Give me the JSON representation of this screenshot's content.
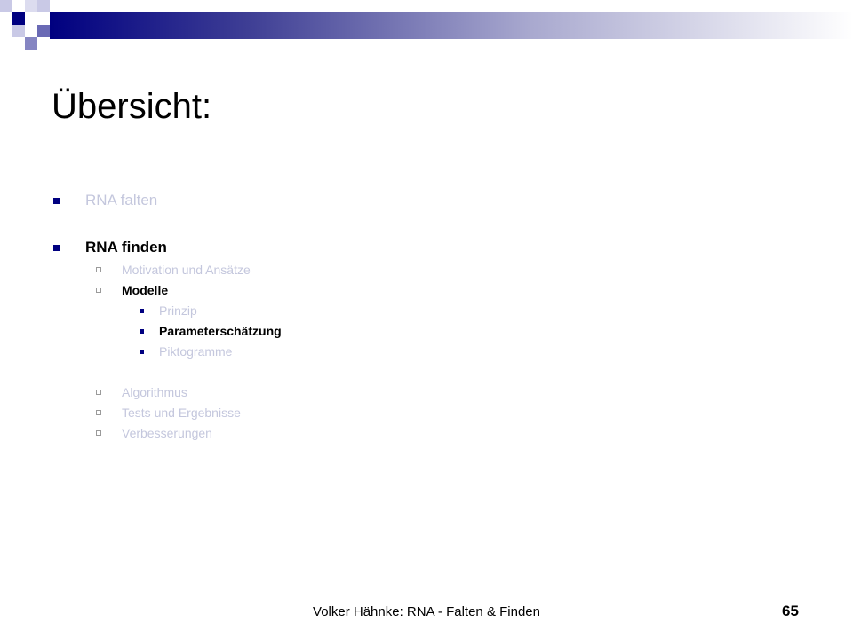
{
  "slide": {
    "title": "Übersicht:",
    "colors": {
      "accent": "#000080",
      "dim_text": "#c4c7dd",
      "active_text": "#000000"
    },
    "outline": [
      {
        "label": "RNA falten",
        "level": 1,
        "state": "dim"
      },
      {
        "label": "RNA finden",
        "level": 1,
        "state": "active"
      },
      {
        "label": "Motivation und Ansätze",
        "level": 2,
        "state": "dim"
      },
      {
        "label": "Modelle",
        "level": 2,
        "state": "active"
      },
      {
        "label": "Prinzip",
        "level": 3,
        "state": "dim"
      },
      {
        "label": "Parameterschätzung",
        "level": 3,
        "state": "active"
      },
      {
        "label": "Piktogramme",
        "level": 3,
        "state": "dim"
      },
      {
        "label": "Algorithmus",
        "level": 2,
        "state": "dim"
      },
      {
        "label": "Tests und Ergebnisse",
        "level": 2,
        "state": "dim"
      },
      {
        "label": "Verbesserungen",
        "level": 2,
        "state": "dim"
      }
    ]
  },
  "footer": {
    "text": "Volker Hähnke: RNA - Falten & Finden",
    "page_number": "65"
  }
}
